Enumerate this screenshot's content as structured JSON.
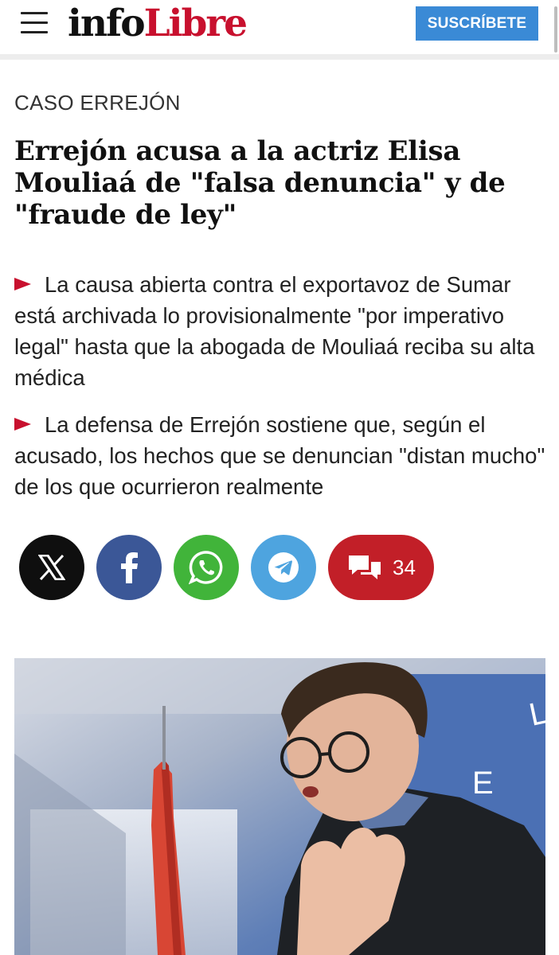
{
  "header": {
    "logo_part1": "info",
    "logo_part2": "Libre",
    "subscribe_label": "SUSCRÍBETE"
  },
  "article": {
    "section": "CASO ERREJÓN",
    "headline": "Errejón acusa a la actriz Elisa Mouliaá de \"falsa denuncia\" y de \"fraude de ley\"",
    "bullets": [
      "La causa abierta contra el exportavoz de Sumar está archivada lo provisionalmente \"por imperativo legal\" hasta que la abogada de Mouliaá reciba su alta médica",
      "La defensa de Errejón sostiene que, según el acusado, los hechos que se denuncian \"distan mucho\" de los que ocurrieron realmente"
    ]
  },
  "share": {
    "buttons": [
      {
        "icon": "x-icon",
        "color": "#0f0f0f"
      },
      {
        "icon": "facebook-icon",
        "color": "#3b5797"
      },
      {
        "icon": "whatsapp-icon",
        "color": "#41b43a"
      },
      {
        "icon": "telegram-icon",
        "color": "#4ea4df"
      }
    ],
    "comments_icon": "comments-icon",
    "comments_count": "34",
    "comments_color": "#c21f28"
  },
  "colors": {
    "brand_red": "#c8102e",
    "subscribe_blue": "#3a8ad6"
  }
}
